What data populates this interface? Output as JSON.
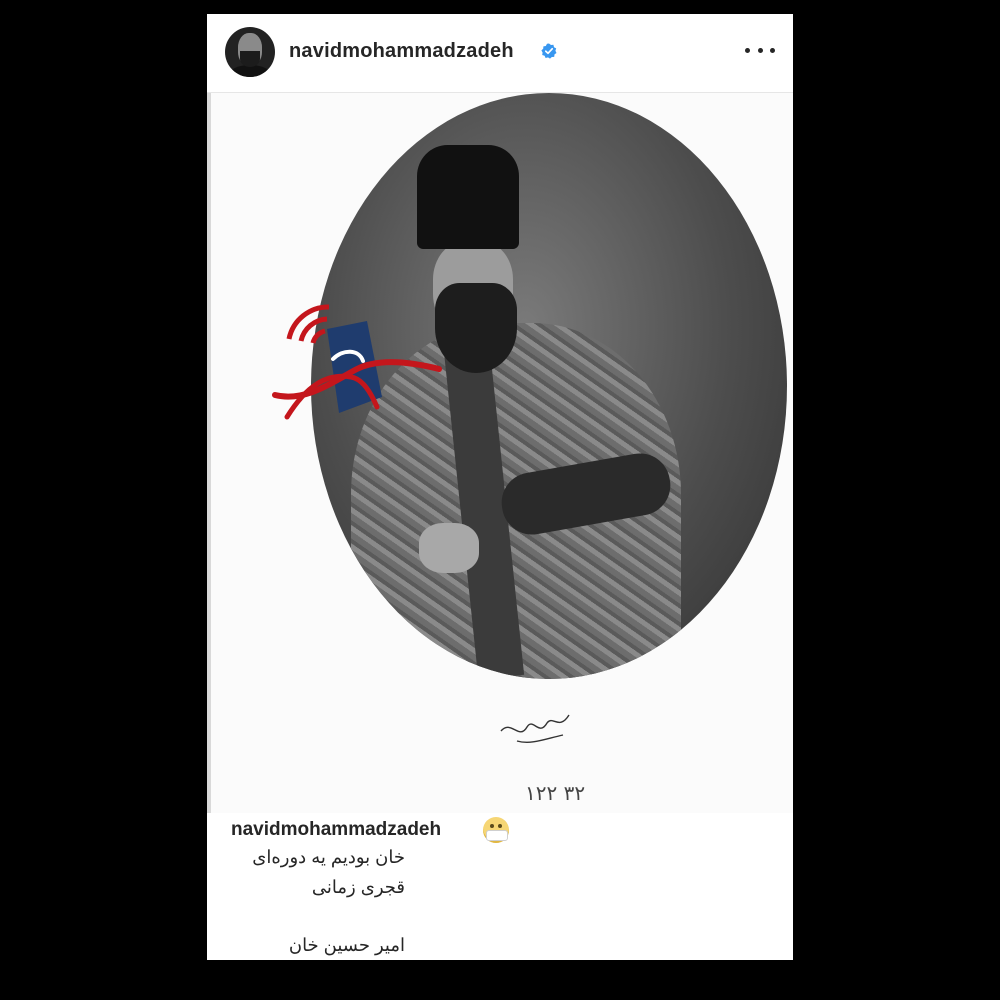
{
  "post": {
    "username": "navidmohammadzadeh",
    "verified": true,
    "more_label": "More options"
  },
  "photo": {
    "plate_number": "۱۲۲ ۳۲"
  },
  "caption": {
    "username": "navidmohammadzadeh",
    "emoji": "mask-face-emoji",
    "lines": [
      "خان بودیم یه دوره‌ای",
      "قجری زمانی",
      "امیر حسین خان"
    ]
  },
  "colors": {
    "background": "#000000",
    "card": "#ffffff",
    "text": "#262626",
    "verified": "#3897f0",
    "logo_red": "#c4161c",
    "logo_blue": "#1f3c6e"
  }
}
